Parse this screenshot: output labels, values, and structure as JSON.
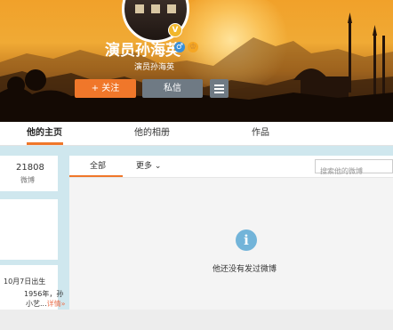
{
  "profile": {
    "name": "演员孙海英",
    "subtitle": "演员孙海英",
    "verified_badge": "V",
    "gender_icon": "♂",
    "vip_icon": "♔"
  },
  "actions": {
    "follow_label": "+ 关注",
    "message_label": "私信",
    "menu_icon": "menu-icon"
  },
  "tabs": [
    {
      "label": "他的主页",
      "active": true
    },
    {
      "label": "他的相册",
      "active": false
    },
    {
      "label": "作品",
      "active": false
    }
  ],
  "stats": {
    "weibo_count": "21808",
    "weibo_label": "微博"
  },
  "bio": {
    "line1": "10月7日出生",
    "line2": "1956年，孙",
    "line3_prefix": "小艺...",
    "more_label": "详情»"
  },
  "feed": {
    "tab_all": "全部",
    "tab_more": "更多",
    "search_placeholder": "搜索他的微博",
    "empty_icon": "info-icon",
    "empty_message": "他还没有发过微博"
  },
  "colors": {
    "accent": "#f0772a",
    "button_gray": "#6f7a84",
    "info_blue": "#72b4d9"
  }
}
